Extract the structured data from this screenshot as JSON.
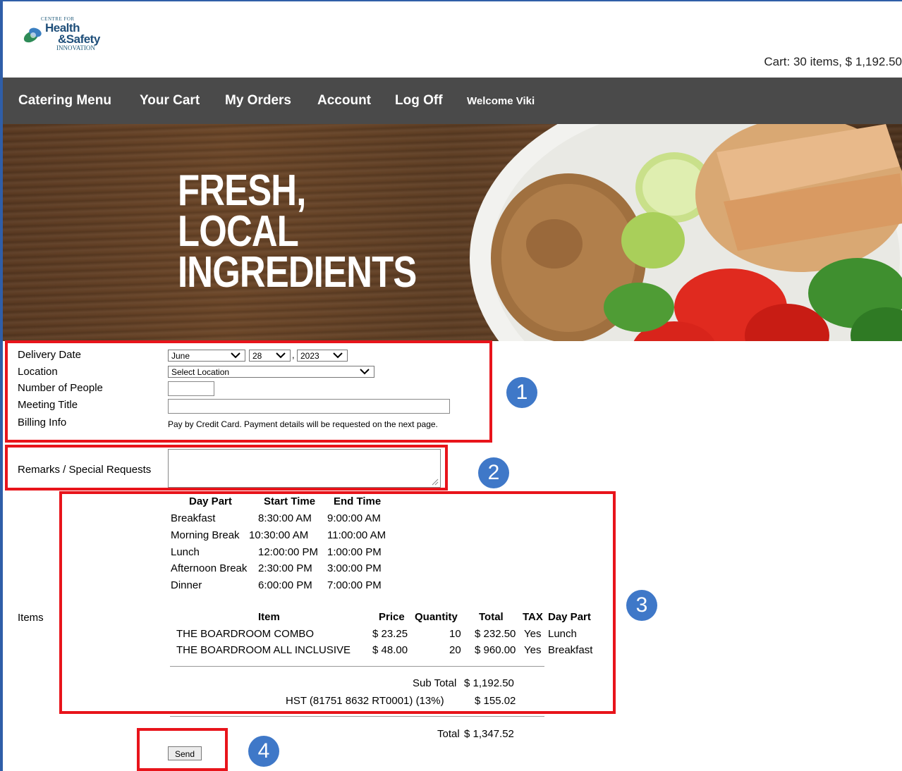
{
  "header": {
    "logo": {
      "top": "CENTRE FOR",
      "line1": "Health",
      "line2": "&Safety",
      "line3": "INNOVATION"
    },
    "cart_summary": "Cart: 30 items, $ 1,192.50"
  },
  "nav": {
    "items": [
      "Catering Menu",
      "Your Cart",
      "My Orders",
      "Account",
      "Log Off"
    ],
    "welcome": "Welcome Viki"
  },
  "banner": {
    "lines": [
      "FRESH,",
      "LOCAL",
      "INGREDIENTS"
    ]
  },
  "form": {
    "delivery_date_label": "Delivery Date",
    "month": "June",
    "day": "28",
    "year": "2023",
    "location_label": "Location",
    "location_value": "Select Location",
    "people_label": "Number of People",
    "people_value": "",
    "meeting_title_label": "Meeting Title",
    "meeting_title_value": "",
    "billing_label": "Billing Info",
    "billing_note": "Pay by Credit Card. Payment details will be requested on the next page.",
    "remarks_label": "Remarks / Special Requests",
    "remarks_value": "",
    "items_label": "Items"
  },
  "schedule": {
    "headers": [
      "Day Part",
      "Start Time",
      "End Time"
    ],
    "rows": [
      [
        "Breakfast",
        "8:30:00 AM",
        "9:00:00 AM"
      ],
      [
        "Morning Break",
        "10:30:00 AM",
        "11:00:00 AM"
      ],
      [
        "Lunch",
        "12:00:00 PM",
        "1:00:00 PM"
      ],
      [
        "Afternoon Break",
        "2:30:00 PM",
        "3:00:00 PM"
      ],
      [
        "Dinner",
        "6:00:00 PM",
        "7:00:00 PM"
      ]
    ]
  },
  "order": {
    "headers": [
      "Item",
      "Price",
      "Quantity",
      "Total",
      "TAX",
      "Day Part"
    ],
    "rows": [
      [
        "THE BOARDROOM COMBO",
        "$ 23.25",
        "10",
        "$ 232.50",
        "Yes",
        "Lunch"
      ],
      [
        "THE BOARDROOM ALL INCLUSIVE",
        "$ 48.00",
        "20",
        "$ 960.00",
        "Yes",
        "Breakfast"
      ]
    ],
    "subtotal_label": "Sub Total",
    "subtotal_value": "$ 1,192.50",
    "hst_label": "HST (81751 8632 RT0001) (13%)",
    "hst_value": "$ 155.02",
    "total_label": "Total",
    "total_value": "$ 1,347.52"
  },
  "send_label": "Send",
  "annotations": [
    "1",
    "2",
    "3",
    "4"
  ],
  "colors": {
    "annotation_red": "#e8141b",
    "badge_blue": "#3f78c8",
    "nav_bg": "#4a4a4a"
  }
}
